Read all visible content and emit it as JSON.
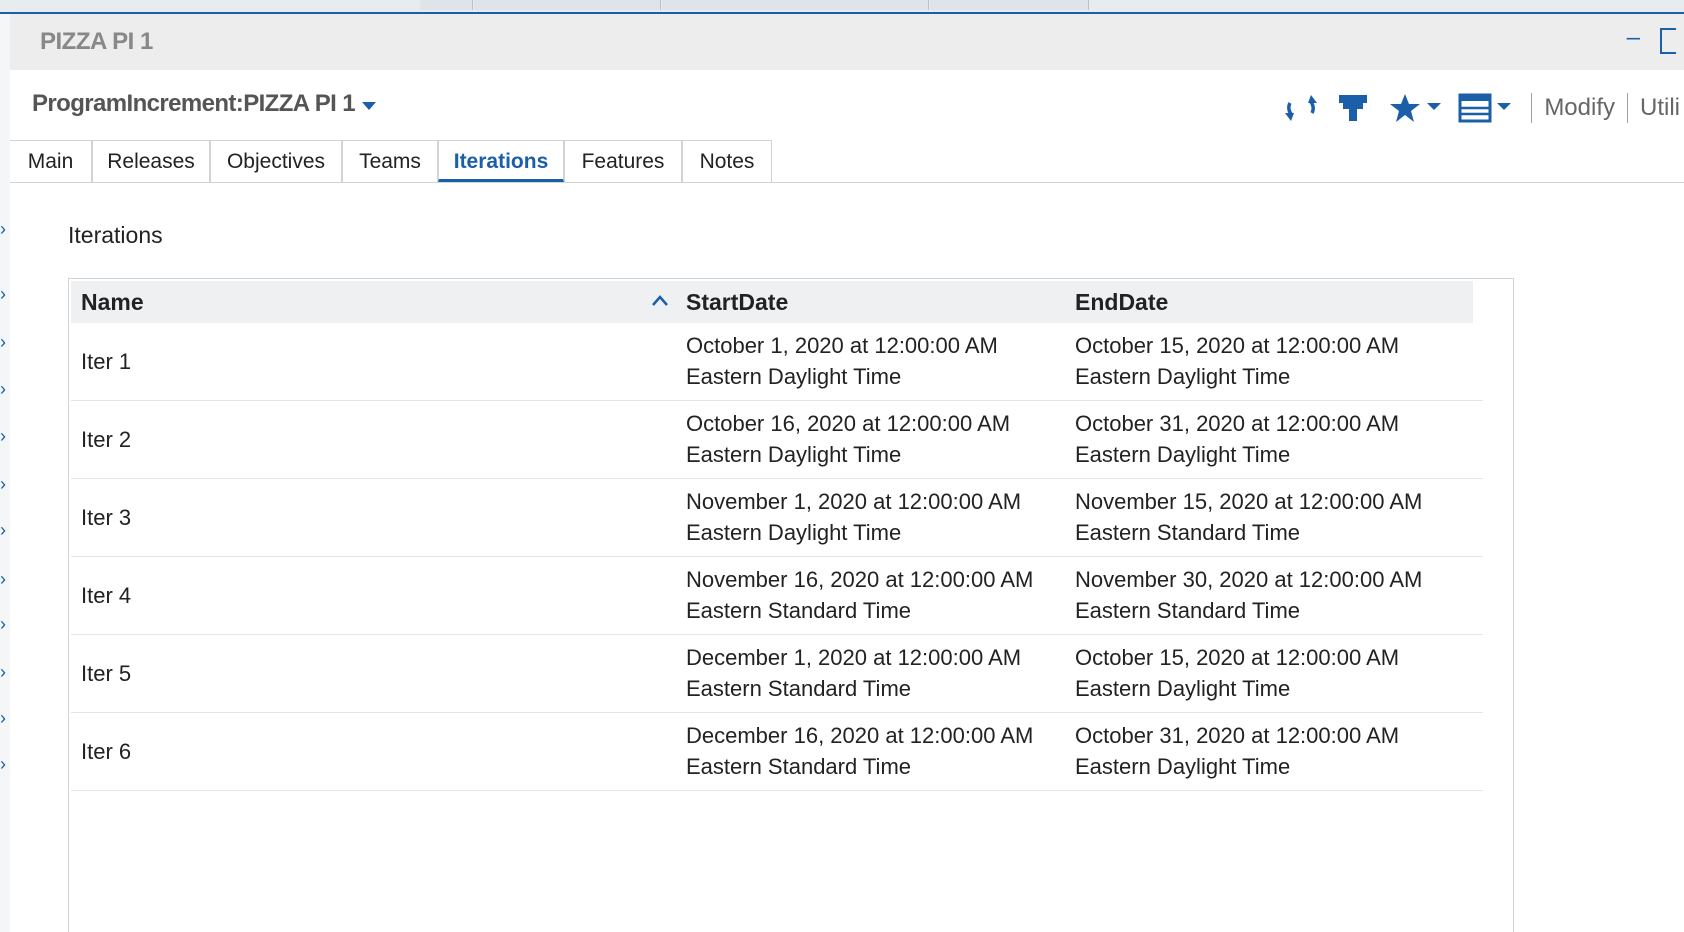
{
  "window": {
    "title": "PIZZA PI 1",
    "minimize_glyph": "–"
  },
  "header": {
    "record_title": "ProgramIncrement:PIZZA PI 1"
  },
  "toolbar": {
    "icons": [
      "refresh-icon",
      "stamp-icon",
      "star-icon",
      "layout-icon"
    ],
    "modify_label": "Modify",
    "utilities_label": "Utili"
  },
  "tabs": [
    {
      "label": "Main",
      "active": false
    },
    {
      "label": "Releases",
      "active": false
    },
    {
      "label": "Objectives",
      "active": false
    },
    {
      "label": "Teams",
      "active": false
    },
    {
      "label": "Iterations",
      "active": true
    },
    {
      "label": "Features",
      "active": false
    },
    {
      "label": "Notes",
      "active": false
    }
  ],
  "section": {
    "label": "Iterations"
  },
  "grid": {
    "columns": {
      "name": "Name",
      "start": "StartDate",
      "end": "EndDate"
    },
    "sort_column": "Name",
    "rows": [
      {
        "name": "Iter 1",
        "start_date": "October 1, 2020 at 12:00:00 AM",
        "start_tz": "Eastern Daylight Time",
        "end_date": "October 15, 2020 at 12:00:00 AM",
        "end_tz": "Eastern Daylight Time"
      },
      {
        "name": "Iter 2",
        "start_date": "October 16, 2020 at 12:00:00 AM",
        "start_tz": "Eastern Daylight Time",
        "end_date": "October 31, 2020 at 12:00:00 AM",
        "end_tz": "Eastern Daylight Time"
      },
      {
        "name": "Iter 3",
        "start_date": "November 1, 2020 at 12:00:00 AM",
        "start_tz": "Eastern Daylight Time",
        "end_date": "November 15, 2020 at 12:00:00 AM",
        "end_tz": "Eastern Standard Time"
      },
      {
        "name": "Iter 4",
        "start_date": "November 16, 2020 at 12:00:00 AM",
        "start_tz": "Eastern Standard Time",
        "end_date": "November 30, 2020 at 12:00:00 AM",
        "end_tz": "Eastern Standard Time"
      },
      {
        "name": "Iter 5",
        "start_date": "December 1, 2020 at 12:00:00 AM",
        "start_tz": "Eastern Standard Time",
        "end_date": "October 15, 2020 at 12:00:00 AM",
        "end_tz": "Eastern Daylight Time"
      },
      {
        "name": "Iter 6",
        "start_date": "December 16, 2020 at 12:00:00 AM",
        "start_tz": "Eastern Standard Time",
        "end_date": "October 31, 2020 at 12:00:00 AM",
        "end_tz": "Eastern Daylight Time"
      }
    ]
  },
  "colors": {
    "accent": "#1a5fa8",
    "titlebar": "#ededed",
    "grid_header": "#eef0f2"
  }
}
